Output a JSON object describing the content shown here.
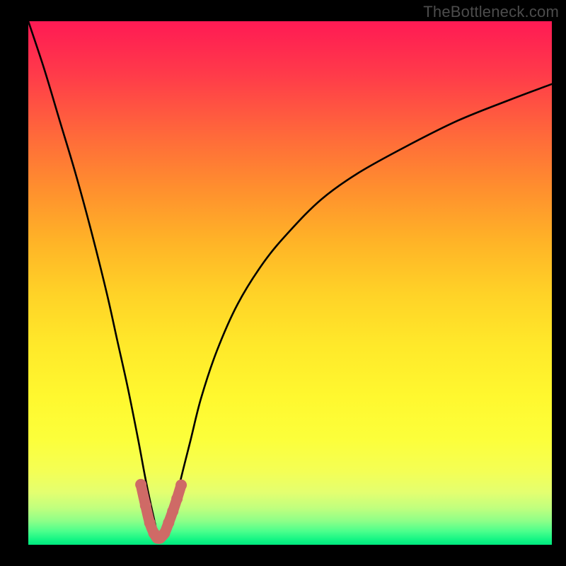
{
  "watermark": "TheBottleneck.com",
  "colors": {
    "background": "#000000",
    "watermark": "#4c4c4c",
    "curve": "#000000",
    "marker_stroke": "#cf6a66",
    "marker_fill": "#cf6a66"
  },
  "chart_data": {
    "type": "line",
    "title": "",
    "xlabel": "",
    "ylabel": "",
    "x_range": [
      0,
      100
    ],
    "y_range": [
      0,
      100
    ],
    "note": "x and y in percent of plot area; y=0 is top (high bottleneck), y=100 is bottom (no bottleneck). Curve minimum (~optimum match) at x≈25.",
    "series": [
      {
        "name": "bottleneck-curve",
        "x": [
          0,
          3,
          6,
          9,
          12,
          15,
          17,
          19,
          21,
          22.5,
          24,
          25,
          26,
          27.5,
          29,
          31,
          33,
          36,
          40,
          45,
          50,
          56,
          63,
          72,
          82,
          92,
          100
        ],
        "y": [
          0,
          9,
          19,
          29,
          40,
          52,
          61,
          70,
          80,
          88,
          95,
          99,
          99,
          95,
          88,
          80,
          72,
          63,
          54,
          46,
          40,
          34,
          29,
          24,
          19,
          15,
          12
        ]
      }
    ],
    "marker": {
      "name": "optimum-region",
      "x": [
        21.5,
        22.4,
        23.2,
        24.0,
        24.6,
        25.2,
        26.0,
        26.8,
        27.6,
        28.4,
        29.2
      ],
      "y": [
        88.5,
        92.5,
        95.8,
        97.8,
        98.7,
        98.7,
        97.8,
        95.8,
        93.6,
        91.2,
        88.6
      ]
    }
  }
}
